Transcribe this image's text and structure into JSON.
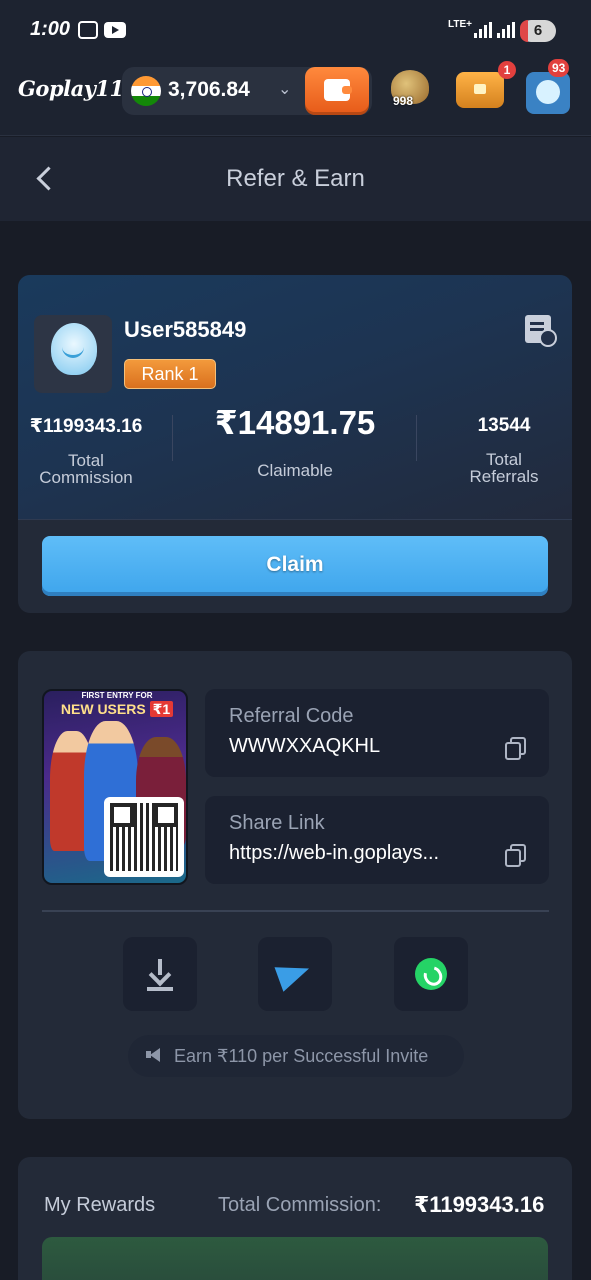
{
  "status_bar": {
    "time": "1:00",
    "network": "LTE+",
    "battery": "6"
  },
  "header": {
    "logo": "Goplay11",
    "balance": "3,706.84",
    "jar_count": "998",
    "chest_badge": "1",
    "avatar_badge": "93"
  },
  "page": {
    "title": "Refer & Earn"
  },
  "profile": {
    "username": "User585849",
    "rank": "Rank 1",
    "total_commission_value": "₹1199343.16",
    "total_commission_label_1": "Total",
    "total_commission_label_2": "Commission",
    "claimable_value": "₹14891.75",
    "claimable_label": "Claimable",
    "total_referrals_value": "13544",
    "total_referrals_label_1": "Total",
    "total_referrals_label_2": "Referrals",
    "claim_label": "Claim"
  },
  "referral": {
    "poster_top": "FIRST ENTRY FOR",
    "poster_main": "NEW USERS",
    "poster_price": "₹1",
    "code_label": "Referral Code",
    "code_value": "WWWXXAQKHL",
    "link_label": "Share Link",
    "link_value": "https://web-in.goplays...",
    "invite_text": "Earn ₹110 per Successful Invite",
    "share_icons": [
      "download-icon",
      "telegram-icon",
      "whatsapp-icon"
    ]
  },
  "rewards": {
    "title": "My Rewards",
    "total_label": "Total Commission:",
    "total_value": "₹1199343.16"
  },
  "colors": {
    "claim": "#4fb3f4",
    "rank": "#e9852c",
    "background": "#181c26",
    "card": "#232a38"
  }
}
